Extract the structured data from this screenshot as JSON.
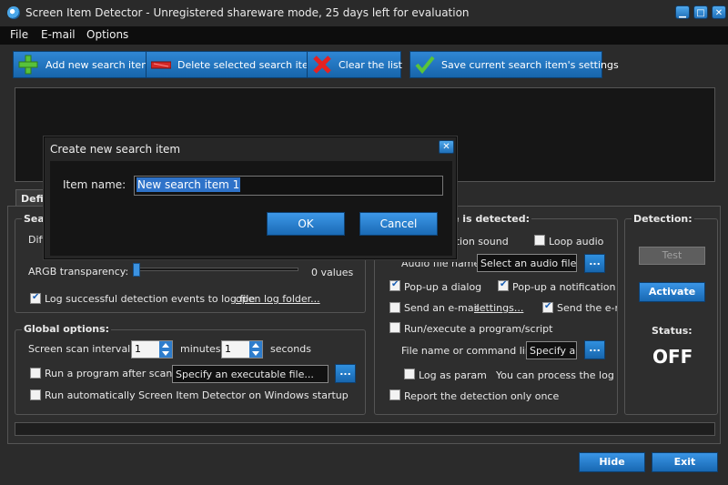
{
  "window": {
    "title": "Screen Item Detector - Unregistered shareware mode, 25 days left for evaluation",
    "min": "▁",
    "max": "□",
    "close": "✕"
  },
  "menu": [
    "File",
    "E-mail",
    "Options"
  ],
  "toolbar": {
    "add": "Add new search item",
    "delete": "Delete selected search item",
    "clear": "Clear the list",
    "save": "Save current search item's settings"
  },
  "tab": {
    "label": "Defi"
  },
  "search_group": {
    "title_partial": "Sea",
    "diff_partial": "Diff",
    "argb_label": "ARGB transparency:",
    "argb_value": "0 values",
    "log_label": "Log successful detection events to log file",
    "log_checked": true,
    "open_log_link": "open log folder..."
  },
  "global_options": {
    "title": "Global options:",
    "scan_interval_label": "Screen scan interval:",
    "minutes_value": "1",
    "minutes_label": "minutes",
    "seconds_value": "1",
    "seconds_label": "seconds",
    "run_program_label": "Run a program after scan:",
    "run_program_checked": false,
    "executable_placeholder": "Specify an executable file...",
    "browse": "...",
    "startup_label": "Run automatically Screen Item Detector on Windows startup",
    "startup_checked": false
  },
  "when_detected": {
    "title_partial": "e is detected:",
    "sound_partial": "ation sound",
    "loop_audio": "Loop audio",
    "loop_checked": false,
    "audio_label_partial": "Audio file name:",
    "audio_field": "Select an audio file els",
    "browse": "...",
    "popup_dialog": "Pop-up a dialog",
    "popup_dialog_checked": true,
    "popup_notification": "Pop-up a notification",
    "popup_notification_checked": true,
    "send_email": "Send an e-mail",
    "send_email_checked": false,
    "settings_link": "settings...",
    "send_email2_partial": "Send the e-ma",
    "send_email2_checked": true,
    "run_execute": "Run/execute a program/script",
    "run_execute_checked": false,
    "file_cmd_label": "File name or command line:",
    "file_cmd_field": "Specify an",
    "log_as_param": "Log as param",
    "log_as_param_checked": false,
    "process_log_partial": "You can process the log afte",
    "report_once": "Report the detection only once",
    "report_once_checked": false
  },
  "detection": {
    "title": "Detection:",
    "test": "Test",
    "activate": "Activate",
    "status_label": "Status:",
    "status_value": "OFF"
  },
  "footer": {
    "hide": "Hide",
    "exit": "Exit"
  },
  "dialog": {
    "title": "Create new search item",
    "close": "✕",
    "item_name_label": "Item name:",
    "item_name_value": "New search item 1",
    "ok": "OK",
    "cancel": "Cancel"
  },
  "colors": {
    "accent": "#1f6fb8",
    "background": "#2b2b2b",
    "status_off": "#ffffff"
  }
}
